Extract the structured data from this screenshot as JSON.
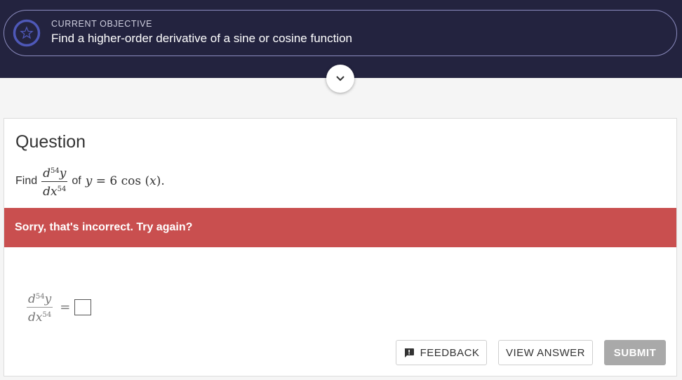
{
  "objective": {
    "label": "CURRENT OBJECTIVE",
    "text": "Find a higher-order derivative of a sine or cosine function",
    "progress": 0.0
  },
  "question": {
    "heading": "Question",
    "find_word": "Find",
    "deriv": {
      "num_d": "d",
      "num_var": "y",
      "order": "54",
      "den_d": "d",
      "den_var": "x"
    },
    "of_word": "of",
    "equation": {
      "lhs": "y",
      "eq": "=",
      "coef": "6",
      "func": "cos",
      "arg": "x",
      "end": "."
    }
  },
  "feedback_banner": "Sorry, that's incorrect. Try again?",
  "answer": {
    "deriv": {
      "num_d": "d",
      "num_var": "y",
      "order": "54",
      "den_d": "d",
      "den_var": "x"
    },
    "eq": "=",
    "value": ""
  },
  "buttons": {
    "feedback": "FEEDBACK",
    "view_answer": "VIEW ANSWER",
    "submit": "SUBMIT"
  },
  "icons": {
    "objective": "star-icon",
    "toggle": "chevron-down-icon",
    "feedback": "comment-alert-icon"
  },
  "colors": {
    "header_bg": "#23233f",
    "error_bg": "#c94f4f",
    "submit_bg": "#a9a9a9"
  }
}
